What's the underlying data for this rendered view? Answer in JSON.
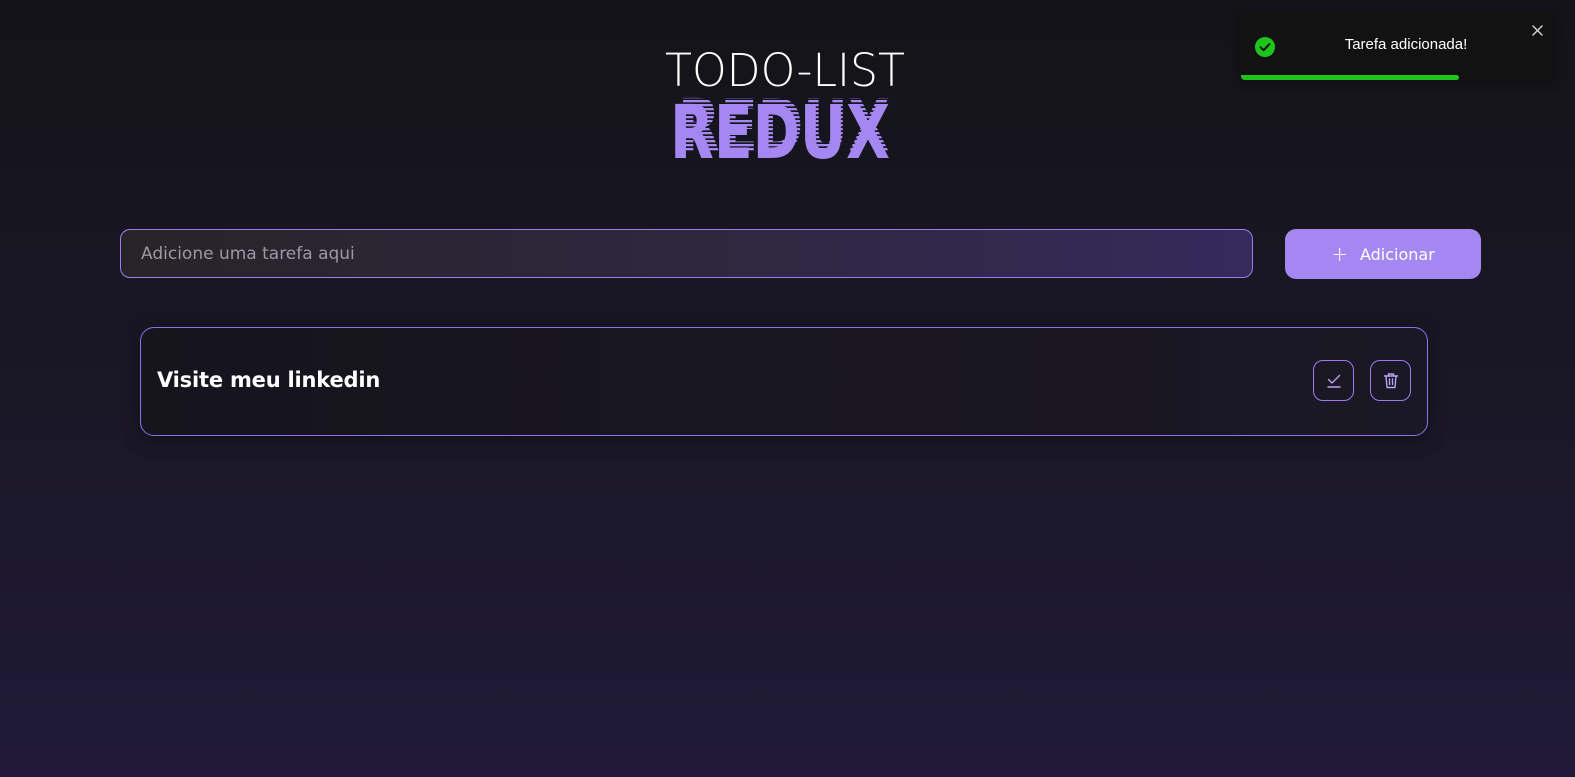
{
  "logo": {
    "top_text": "TODO-LIST",
    "bottom_text": "REDUX",
    "accent_color": "#a487f0"
  },
  "task_input": {
    "value": "",
    "placeholder": "Adicione uma tarefa aqui"
  },
  "add_button": {
    "icon": "plus-icon",
    "label": "Adicionar"
  },
  "tasks": [
    {
      "title": "Visite meu linkedin",
      "actions": [
        "check-icon",
        "trash-icon"
      ]
    }
  ],
  "toast": {
    "type": "success",
    "icon": "check-circle-icon",
    "message": "Tarefa adicionada!",
    "close_icon": "close-icon",
    "progress": 0.7,
    "progress_color": "#1fc41a"
  },
  "colors": {
    "accent": "#a487f0",
    "border": "#9a7cf0",
    "success": "#1fc41a"
  }
}
